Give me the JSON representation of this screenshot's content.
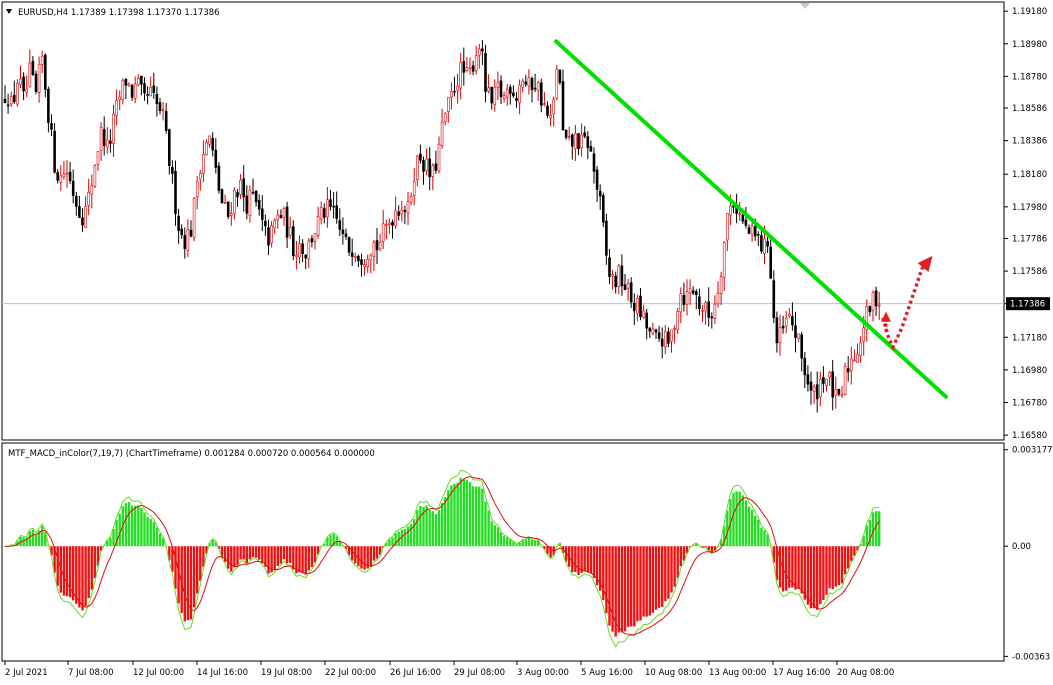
{
  "window": {
    "symbol_header": "EURUSD,H4  1.17389 1.17398 1.17370 1.17386",
    "indicator_header": "MTF_MACD_inColor(7,19,7) (ChartTimeframe) 0.001284 0.000720 0.000564 0.000000"
  },
  "chart_data": [
    {
      "type": "candlestick",
      "title": "EURUSD,H4",
      "ohlc_last": {
        "open": 1.17389,
        "high": 1.17398,
        "low": 1.1737,
        "close": 1.17386
      },
      "current_price_label": "1.17386",
      "current_price": 1.17386,
      "y_ticks": [
        "1.19180",
        "1.18980",
        "1.18780",
        "1.18586",
        "1.18386",
        "1.18180",
        "1.17980",
        "1.17786",
        "1.17586",
        "1.17386",
        "1.17180",
        "1.16980",
        "1.16780",
        "1.16580"
      ],
      "y_tick_values": [
        1.1918,
        1.1898,
        1.1878,
        1.18586,
        1.18386,
        1.1818,
        1.1798,
        1.17786,
        1.17586,
        1.17386,
        1.1718,
        1.1698,
        1.1678,
        1.1658
      ],
      "ylim": [
        1.1655,
        1.1923
      ],
      "price_path": [
        [
          0,
          1.1845
        ],
        [
          6,
          1.1872
        ],
        [
          12,
          1.1858
        ],
        [
          18,
          1.1878
        ],
        [
          24,
          1.1862
        ],
        [
          30,
          1.188
        ],
        [
          36,
          1.1866
        ],
        [
          42,
          1.189
        ],
        [
          48,
          1.1858
        ],
        [
          54,
          1.1826
        ],
        [
          60,
          1.1815
        ],
        [
          66,
          1.1822
        ],
        [
          72,
          1.181
        ],
        [
          78,
          1.1798
        ],
        [
          84,
          1.1792
        ],
        [
          90,
          1.1806
        ],
        [
          96,
          1.183
        ],
        [
          102,
          1.1845
        ],
        [
          108,
          1.1832
        ],
        [
          114,
          1.1851
        ],
        [
          120,
          1.1866
        ],
        [
          126,
          1.1876
        ],
        [
          132,
          1.1868
        ],
        [
          138,
          1.1872
        ],
        [
          144,
          1.1862
        ],
        [
          150,
          1.1868
        ],
        [
          156,
          1.186
        ],
        [
          162,
          1.1856
        ],
        [
          168,
          1.1832
        ],
        [
          174,
          1.1806
        ],
        [
          180,
          1.1782
        ],
        [
          186,
          1.1778
        ],
        [
          192,
          1.1786
        ],
        [
          198,
          1.182
        ],
        [
          204,
          1.1833
        ],
        [
          210,
          1.184
        ],
        [
          216,
          1.1818
        ],
        [
          222,
          1.18
        ],
        [
          228,
          1.1792
        ],
        [
          234,
          1.1806
        ],
        [
          240,
          1.1812
        ],
        [
          246,
          1.18
        ],
        [
          252,
          1.1804
        ],
        [
          258,
          1.1796
        ],
        [
          264,
          1.1782
        ],
        [
          270,
          1.1778
        ],
        [
          276,
          1.179
        ],
        [
          282,
          1.1794
        ],
        [
          288,
          1.1784
        ],
        [
          294,
          1.1772
        ],
        [
          300,
          1.1776
        ],
        [
          306,
          1.177
        ],
        [
          312,
          1.178
        ],
        [
          318,
          1.1788
        ],
        [
          324,
          1.1795
        ],
        [
          330,
          1.1796
        ],
        [
          336,
          1.179
        ],
        [
          342,
          1.178
        ],
        [
          348,
          1.1772
        ],
        [
          354,
          1.1775
        ],
        [
          360,
          1.1768
        ],
        [
          366,
          1.177
        ],
        [
          372,
          1.1776
        ],
        [
          378,
          1.1774
        ],
        [
          384,
          1.1782
        ],
        [
          390,
          1.179
        ],
        [
          396,
          1.1797
        ],
        [
          402,
          1.18
        ],
        [
          408,
          1.1795
        ],
        [
          414,
          1.182
        ],
        [
          420,
          1.183
        ],
        [
          426,
          1.1822
        ],
        [
          432,
          1.1815
        ],
        [
          438,
          1.183
        ],
        [
          444,
          1.1852
        ],
        [
          450,
          1.1862
        ],
        [
          456,
          1.1876
        ],
        [
          462,
          1.1882
        ],
        [
          468,
          1.1876
        ],
        [
          474,
          1.1889
        ],
        [
          480,
          1.19
        ],
        [
          486,
          1.1868
        ],
        [
          492,
          1.186
        ],
        [
          498,
          1.187
        ],
        [
          504,
          1.1865
        ],
        [
          510,
          1.1874
        ],
        [
          516,
          1.1866
        ],
        [
          522,
          1.1878
        ],
        [
          528,
          1.187
        ],
        [
          534,
          1.1876
        ],
        [
          540,
          1.1868
        ],
        [
          546,
          1.1855
        ],
        [
          552,
          1.1848
        ],
        [
          558,
          1.1894
        ],
        [
          562,
          1.1845
        ],
        [
          566,
          1.1836
        ],
        [
          570,
          1.1835
        ],
        [
          576,
          1.184
        ],
        [
          582,
          1.1836
        ],
        [
          588,
          1.1838
        ],
        [
          594,
          1.182
        ],
        [
          600,
          1.18
        ],
        [
          604,
          1.178
        ],
        [
          608,
          1.1758
        ],
        [
          614,
          1.1752
        ],
        [
          620,
          1.1756
        ],
        [
          626,
          1.1748
        ],
        [
          632,
          1.174
        ],
        [
          638,
          1.1736
        ],
        [
          644,
          1.1728
        ],
        [
          650,
          1.172
        ],
        [
          656,
          1.1716
        ],
        [
          662,
          1.1718
        ],
        [
          668,
          1.1712
        ],
        [
          674,
          1.1726
        ],
        [
          680,
          1.1746
        ],
        [
          686,
          1.1742
        ],
        [
          692,
          1.1749
        ],
        [
          698,
          1.174
        ],
        [
          704,
          1.1735
        ],
        [
          710,
          1.173
        ],
        [
          716,
          1.1742
        ],
        [
          722,
          1.1765
        ],
        [
          728,
          1.1796
        ],
        [
          734,
          1.1802
        ],
        [
          740,
          1.1792
        ],
        [
          746,
          1.1784
        ],
        [
          752,
          1.178
        ],
        [
          758,
          1.1778
        ],
        [
          764,
          1.1771
        ],
        [
          768,
          1.178
        ],
        [
          772,
          1.1744
        ],
        [
          776,
          1.1713
        ],
        [
          782,
          1.172
        ],
        [
          788,
          1.173
        ],
        [
          794,
          1.1724
        ],
        [
          800,
          1.171
        ],
        [
          806,
          1.1695
        ],
        [
          812,
          1.168
        ],
        [
          818,
          1.1688
        ],
        [
          824,
          1.1696
        ],
        [
          830,
          1.169
        ],
        [
          836,
          1.1679
        ],
        [
          840,
          1.1676
        ],
        [
          846,
          1.1698
        ],
        [
          852,
          1.1705
        ],
        [
          858,
          1.1712
        ],
        [
          864,
          1.1726
        ],
        [
          870,
          1.1736
        ],
        [
          876,
          1.1744
        ],
        [
          880,
          1.17386
        ]
      ],
      "trendline": {
        "x1": 556,
        "y1": 1.18995,
        "x2": 946,
        "y2": 1.16815,
        "color": "#00e000"
      },
      "forecast_arrow": {
        "points": [
          [
            883,
            1.173
          ],
          [
            889,
            1.1717
          ],
          [
            893,
            1.1712
          ],
          [
            902,
            1.1724
          ],
          [
            912,
            1.1742
          ],
          [
            922,
            1.176
          ],
          [
            930,
            1.1766
          ]
        ],
        "color": "#e02020"
      }
    },
    {
      "type": "histogram",
      "title": "MTF_MACD_inColor(7,19,7) (ChartTimeframe)",
      "values_header": [
        "0.001284",
        "0.000720",
        "0.000564",
        "0.000000"
      ],
      "y_ticks": [
        "0.003177",
        "0.00",
        "-0.00363"
      ],
      "y_tick_values": [
        0.003177,
        0.0,
        -0.00363
      ],
      "ylim": [
        -0.00375,
        0.0033
      ],
      "histogram_color_pos": "#22dd22",
      "histogram_color_neg": "#ee1111",
      "signal_colors": [
        "#66dd22",
        "#dd1111"
      ]
    }
  ],
  "x_axis_labels": [
    "2 Jul 2021",
    "7 Jul 08:00",
    "12 Jul 00:00",
    "14 Jul 16:00",
    "19 Jul 08:00",
    "22 Jul 00:00",
    "26 Jul 16:00",
    "29 Jul 08:00",
    "3 Aug 00:00",
    "5 Aug 16:00",
    "10 Aug 08:00",
    "13 Aug 00:00",
    "17 Aug 16:00",
    "20 Aug 08:00"
  ],
  "colors": {
    "bull_candle": "#dd0000",
    "bear_candle": "#000000",
    "grid_line": "#c8c8c8"
  }
}
